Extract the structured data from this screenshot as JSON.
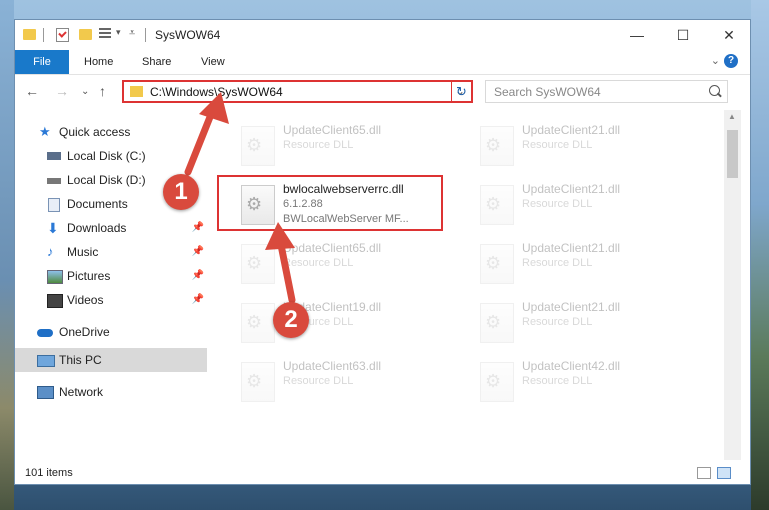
{
  "window": {
    "title": "SysWOW64",
    "minimize": "—",
    "maximize": "☐",
    "close": "✕"
  },
  "ribbon": {
    "tabs": [
      "File",
      "Home",
      "Share",
      "View"
    ],
    "help": "?"
  },
  "address": {
    "path": "C:\\Windows\\SysWOW64",
    "search_placeholder": "Search SysWOW64"
  },
  "nav": {
    "items": [
      {
        "label": "Quick access"
      },
      {
        "label": "Local Disk (C:)"
      },
      {
        "label": "Local Disk (D:)"
      },
      {
        "label": "Documents"
      },
      {
        "label": "Downloads"
      },
      {
        "label": "Music"
      },
      {
        "label": "Pictures"
      },
      {
        "label": "Videos"
      },
      {
        "label": "OneDrive"
      },
      {
        "label": "This PC"
      },
      {
        "label": "Network"
      }
    ]
  },
  "files": {
    "left": [
      {
        "name": "UpdateClient65.dll",
        "sub1": "Resource DLL"
      },
      {
        "name": "bwlocalwebserverrc.dll",
        "sub1": "6.1.2.88",
        "sub2": "BWLocalWebServer MF..."
      },
      {
        "name": "UpdateClient65.dll",
        "sub1": "Resource DLL"
      },
      {
        "name": "UpdateClient19.dll",
        "sub1": "Resource DLL"
      },
      {
        "name": "UpdateClient63.dll",
        "sub1": "Resource DLL"
      }
    ],
    "right": [
      {
        "name": "UpdateClient21.dll",
        "sub1": "Resource DLL"
      },
      {
        "name": "UpdateClient21.dll",
        "sub1": "Resource DLL"
      },
      {
        "name": "UpdateClient21.dll",
        "sub1": "Resource DLL"
      },
      {
        "name": "UpdateClient21.dll",
        "sub1": "Resource DLL"
      },
      {
        "name": "UpdateClient42.dll",
        "sub1": "Resource DLL"
      }
    ]
  },
  "status": {
    "item_count": "101 items"
  },
  "annotations": {
    "marker1": "1",
    "marker2": "2",
    "color": "#d94a3d"
  }
}
